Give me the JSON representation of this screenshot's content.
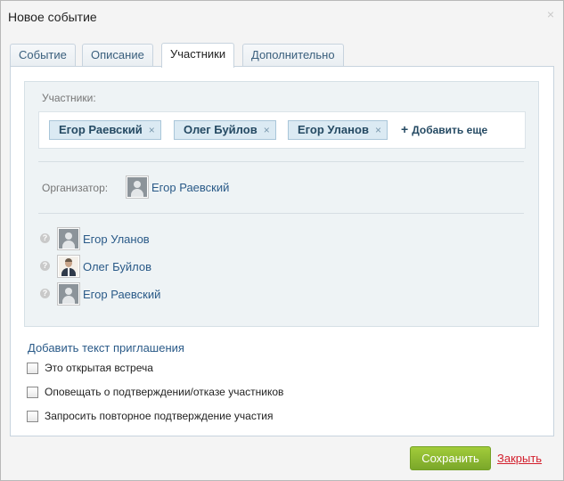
{
  "dialog": {
    "title": "Новое событие",
    "close_icon": "close-icon",
    "close_glyph": "×"
  },
  "tabs": [
    {
      "label": "Событие",
      "active": false
    },
    {
      "label": "Описание",
      "active": false
    },
    {
      "label": "Участники",
      "active": true
    },
    {
      "label": "Дополнительно",
      "active": false
    }
  ],
  "participants_section": {
    "label": "Участники:",
    "chips": [
      {
        "name": "Егор Раевский",
        "remove_glyph": "×"
      },
      {
        "name": "Олег Буйлов",
        "remove_glyph": "×"
      },
      {
        "name": "Егор Уланов",
        "remove_glyph": "×"
      }
    ],
    "add_more": {
      "plus": "+",
      "label": "Добавить еще"
    }
  },
  "organizer": {
    "label": "Организатор:",
    "name": "Егор Раевский",
    "avatar": "user-placeholder-icon"
  },
  "attendees": [
    {
      "name": "Егор Уланов",
      "status_icon": "question-icon",
      "status_glyph": "?",
      "avatar": "user-placeholder-icon"
    },
    {
      "name": "Олег Буйлов",
      "status_icon": "question-icon",
      "status_glyph": "?",
      "avatar": "user-photo"
    },
    {
      "name": "Егор Раевский",
      "status_icon": "question-icon",
      "status_glyph": "?",
      "avatar": "user-placeholder-icon"
    }
  ],
  "invite_link": "Добавить текст приглашения",
  "checkboxes": [
    {
      "label": "Это открытая встреча",
      "checked": false
    },
    {
      "label": "Оповещать о подтверждении/отказе участников",
      "checked": false
    },
    {
      "label": "Запросить повторное подтверждение участия",
      "checked": false
    }
  ],
  "footer": {
    "save_label": "Сохранить",
    "close_label": "Закрыть"
  },
  "colors": {
    "accent_link": "#2a5a88",
    "save_button": "#8dba32",
    "close_link": "#d3202e",
    "chip_bg": "#dbeaf3"
  }
}
